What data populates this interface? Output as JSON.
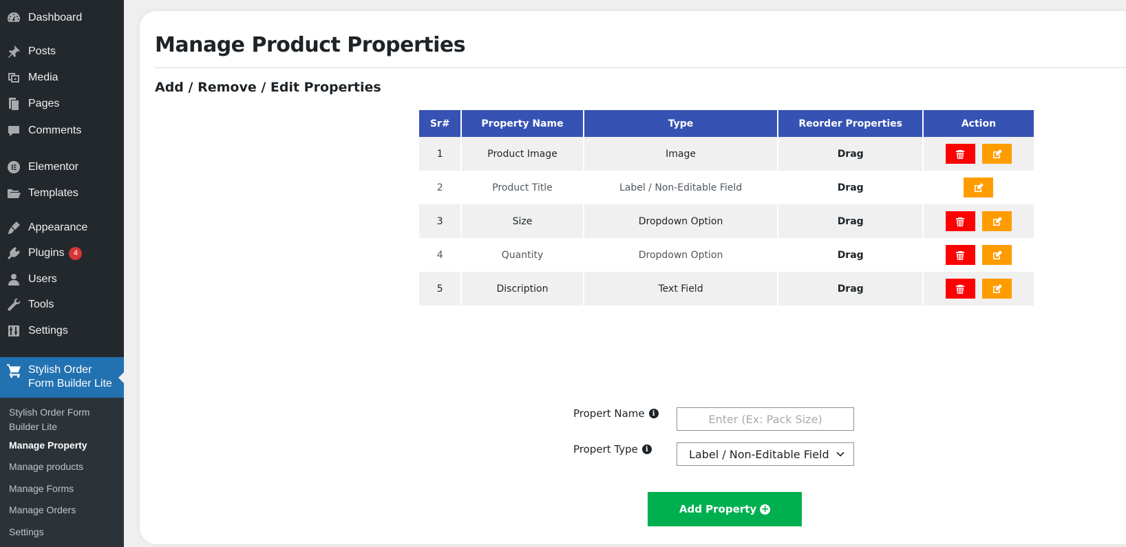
{
  "sidebar": {
    "items": [
      {
        "label": "Dashboard",
        "icon": "dashboard-icon"
      },
      {
        "label": "Posts",
        "icon": "pin-icon"
      },
      {
        "label": "Media",
        "icon": "media-icon"
      },
      {
        "label": "Pages",
        "icon": "pages-icon"
      },
      {
        "label": "Comments",
        "icon": "comment-icon"
      },
      {
        "label": "Elementor",
        "icon": "elementor-icon"
      },
      {
        "label": "Templates",
        "icon": "folder-icon"
      },
      {
        "label": "Appearance",
        "icon": "brush-icon"
      },
      {
        "label": "Plugins",
        "icon": "plugin-icon",
        "badge": "4"
      },
      {
        "label": "Users",
        "icon": "user-icon"
      },
      {
        "label": "Tools",
        "icon": "wrench-icon"
      },
      {
        "label": "Settings",
        "icon": "settings-icon"
      }
    ],
    "active": {
      "label": "Stylish Order Form Builder Lite",
      "icon": "cart-icon"
    },
    "submenu": [
      "Stylish Order Form Builder Lite",
      "Manage Property",
      "Manage products",
      "Manage Forms",
      "Manage Orders",
      "Settings"
    ],
    "submenu_current": "Manage Property"
  },
  "page": {
    "title": "Manage Product Properties",
    "section_title": "Add / Remove / Edit Properties"
  },
  "table": {
    "headers": [
      "Sr#",
      "Property Name",
      "Type",
      "Reorder Properties",
      "Action"
    ],
    "rows": [
      {
        "sr": "1",
        "name": "Product Image",
        "type": "Image",
        "reorder": "Drag",
        "deletable": true
      },
      {
        "sr": "2",
        "name": "Product Title",
        "type": "Label / Non-Editable Field",
        "reorder": "Drag",
        "deletable": false
      },
      {
        "sr": "3",
        "name": "Size",
        "type": "Dropdown Option",
        "reorder": "Drag",
        "deletable": true
      },
      {
        "sr": "4",
        "name": "Quantity",
        "type": "Dropdown Option",
        "reorder": "Drag",
        "deletable": true
      },
      {
        "sr": "5",
        "name": "Discription",
        "type": "Text Field",
        "reorder": "Drag",
        "deletable": true
      }
    ]
  },
  "form": {
    "name_label": "Propert Name",
    "name_placeholder": "Enter (Ex: Pack Size)",
    "name_value": "",
    "type_label": "Propert Type",
    "type_value": "Label / Non-Editable Field",
    "submit_label": "Add Property"
  },
  "colors": {
    "sidebar_bg": "#23282d",
    "active_menu": "#2271b1",
    "table_header": "#3652b3",
    "delete_button": "#ff0000",
    "edit_button": "#ff9c00",
    "add_button": "#00b050",
    "badge": "#d63638"
  }
}
